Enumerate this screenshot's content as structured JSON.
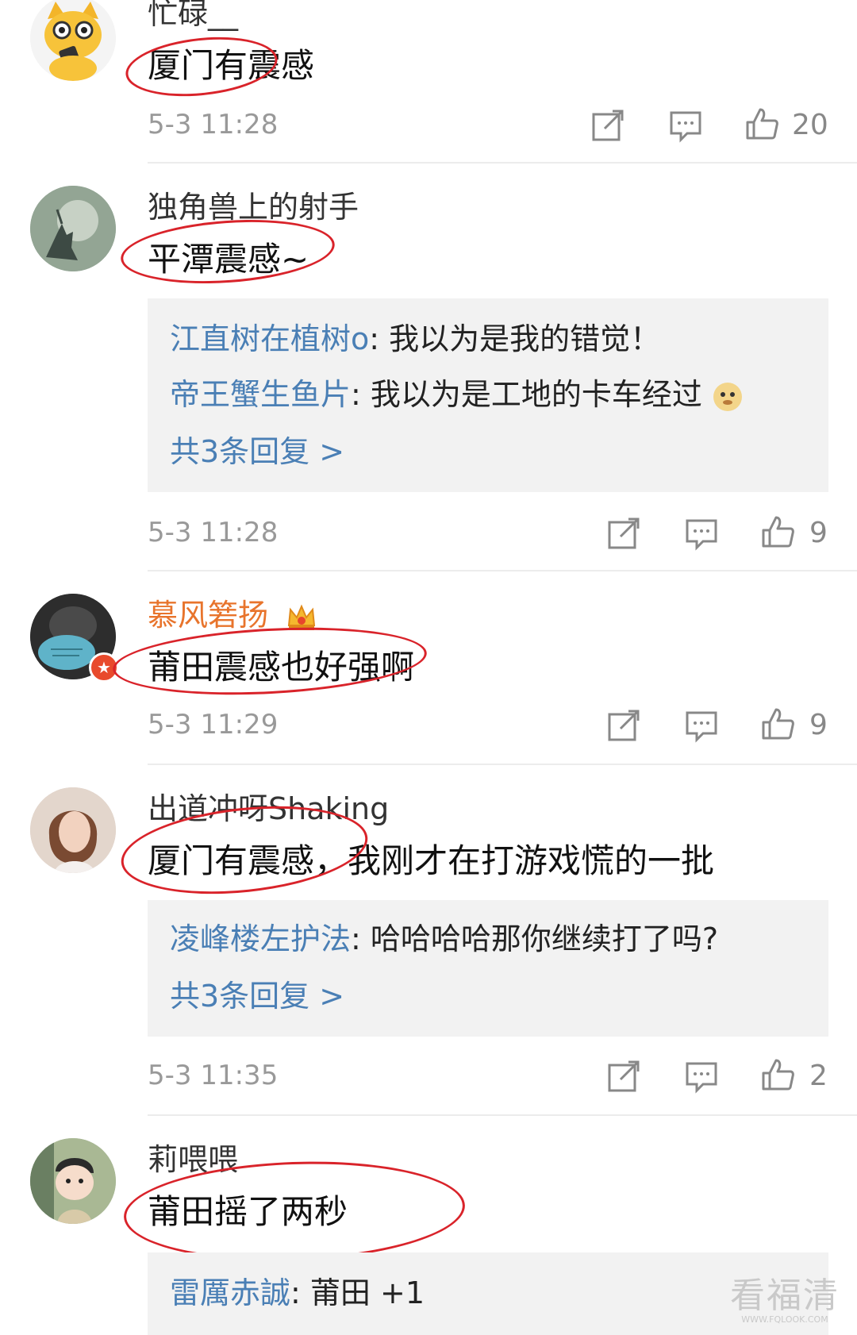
{
  "comments": [
    {
      "username": "忙碌__",
      "content": "厦门有震感",
      "time": "5-3 11:28",
      "likes": "20"
    },
    {
      "username": "独角兽上的射手",
      "content": "平潭震感~",
      "replies": [
        {
          "name": "江直树在植树o",
          "text": ": 我以为是我的错觉！"
        },
        {
          "name": "帝王蟹生鱼片",
          "text": ": 我以为是工地的卡车经过"
        }
      ],
      "more": "共3条回复 >",
      "time": "5-3 11:28",
      "likes": "9"
    },
    {
      "username": "慕风箬扬",
      "content": "莆田震感也好强啊",
      "time": "5-3 11:29",
      "likes": "9"
    },
    {
      "username": "出道冲呀Shaking",
      "content": "厦门有震感，我刚才在打游戏慌的一批",
      "replies": [
        {
          "name": "凌峰楼左护法",
          "text": ": 哈哈哈哈那你继续打了吗?"
        }
      ],
      "more": "共3条回复 >",
      "time": "5-3 11:35",
      "likes": "2"
    },
    {
      "username": "莉喂喂",
      "content": "莆田摇了两秒",
      "replies": [
        {
          "name": "雷厲赤誠",
          "text": ": 莆田 +1"
        }
      ]
    }
  ],
  "watermark": {
    "title": "看福清",
    "url": "WWW.FQLOOK.COM"
  },
  "icons": {
    "share": "share-icon",
    "comment": "comment-icon",
    "like": "thumbs-up-icon",
    "vip": "crown-icon",
    "verified": "verified-badge-icon",
    "emoji": "doge-emoji-icon"
  },
  "colors": {
    "link": "#4a7fb5",
    "vip_name": "#e8742c",
    "annotation": "#d9232a",
    "reply_bg": "#f2f2f2"
  }
}
